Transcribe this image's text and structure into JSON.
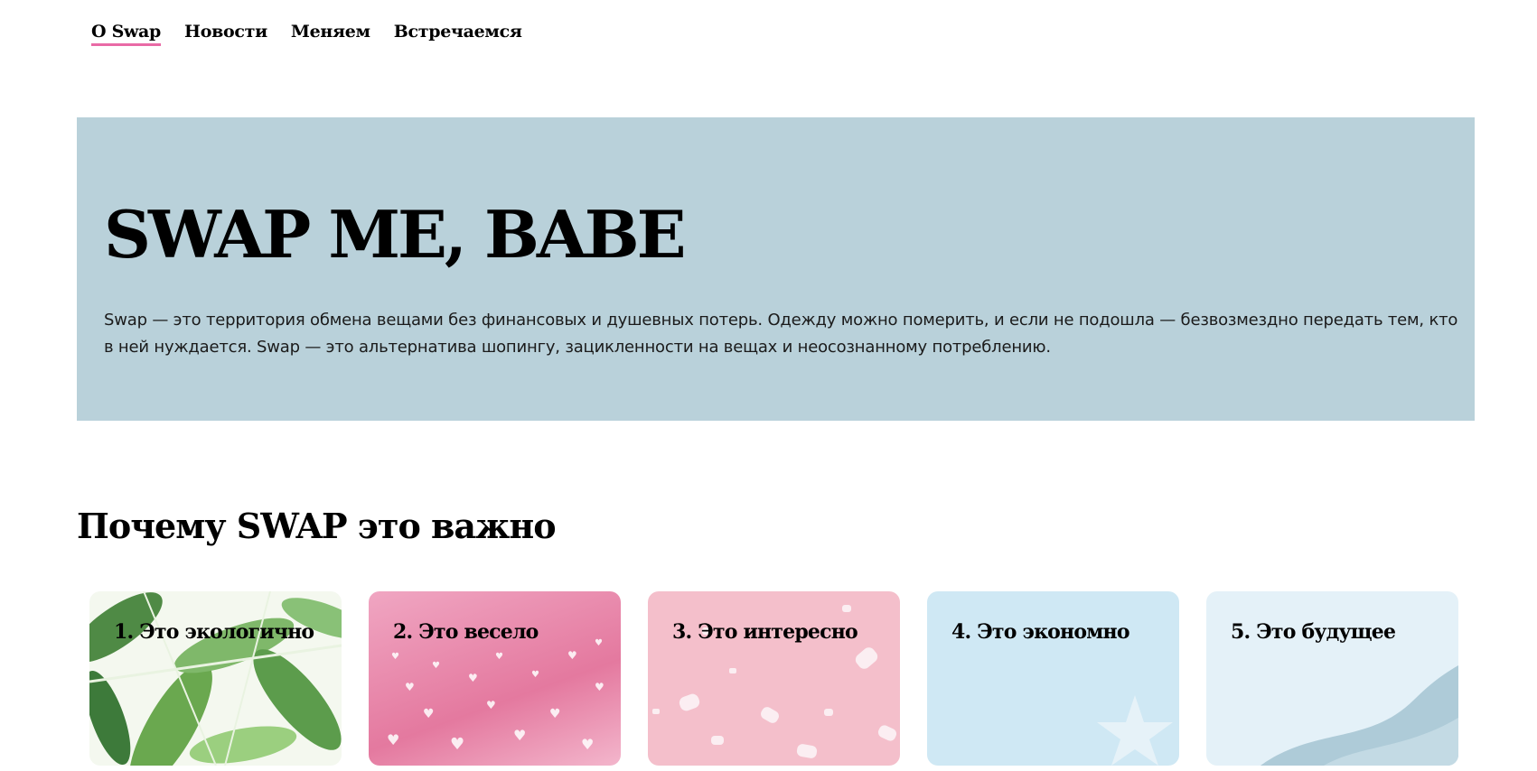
{
  "nav": {
    "items": [
      {
        "label": "О Swap",
        "active": true
      },
      {
        "label": "Новости",
        "active": false
      },
      {
        "label": "Меняем",
        "active": false
      },
      {
        "label": "Встречаемся",
        "active": false
      }
    ]
  },
  "hero": {
    "title": "SWAP ME, BABE",
    "text": "Swap — это территория обмена вещами без финансовых и душевных потерь. Одежду можно померить, и если не подошла — безвозмездно передать тем, кто в ней нуждается. Swap — это альтернатива шопингу, зацикленности на вещах и неосознанному потреблению."
  },
  "section": {
    "title": "Почему SWAP это важно"
  },
  "cards": [
    {
      "title": "1. Это экологично",
      "theme": "tropical-leaves"
    },
    {
      "title": "2. Это весело",
      "theme": "pink-hearts-bokeh"
    },
    {
      "title": "3. Это интересно",
      "theme": "pink-marshmallows"
    },
    {
      "title": "4. Это экономно",
      "theme": "light-blue-star"
    },
    {
      "title": "5. Это будущее",
      "theme": "pale-blue-wave"
    }
  ],
  "colors": {
    "accent": "#e96aa6",
    "hero_bg": "#b9d1da"
  }
}
